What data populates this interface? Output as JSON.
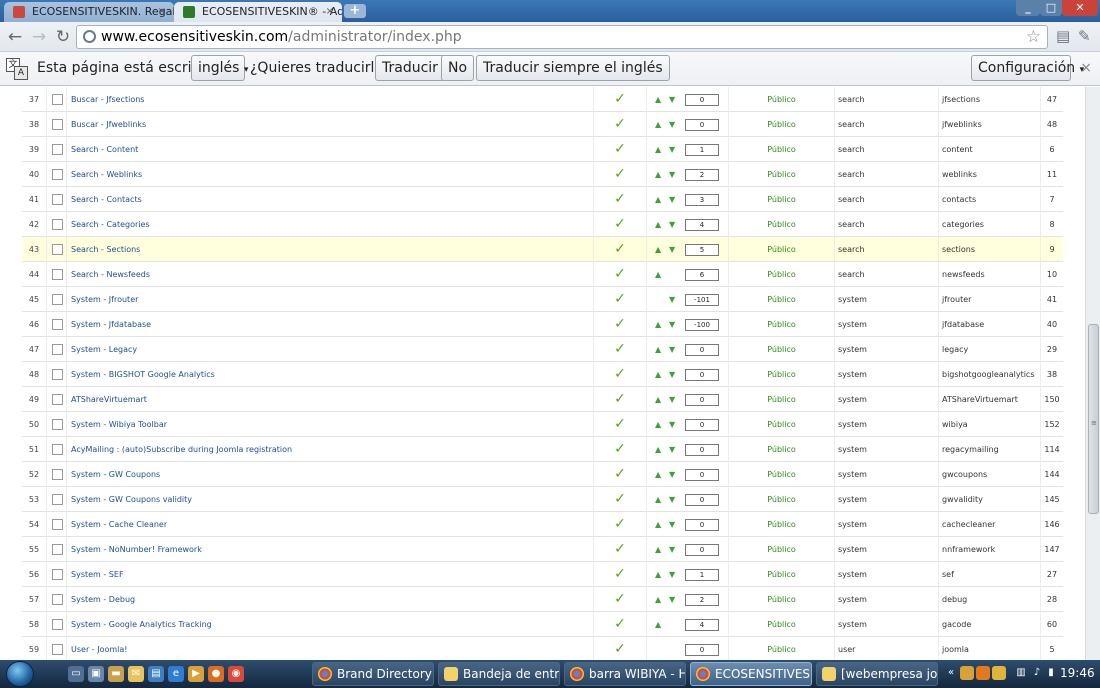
{
  "browser": {
    "tabs": [
      {
        "label": "ECOSENSITIVESKIN. Regalo",
        "close": "×"
      },
      {
        "label": "ECOSENSITIVESKIN® - Adm",
        "close": "×"
      }
    ],
    "new_tab": "+",
    "url_host": "www.ecosensitiveskin.com",
    "url_path": "/administrator/index.php"
  },
  "translate_bar": {
    "text": "Esta página está escrita en",
    "language": "inglés",
    "question": "¿Quieres traducirla?",
    "translate_button": "Traducir",
    "no_button": "No",
    "always_button": "Traducir siempre el inglés",
    "config_button": "Configuración",
    "close": "×"
  },
  "colors": {
    "link": "#1d4f91",
    "enabled_check": "#56a21d",
    "access_public": "#2f8a16",
    "highlight_row": "#ffffdd"
  },
  "rows": [
    {
      "num": "37",
      "name": "Buscar - Jfsections",
      "up": true,
      "down": true,
      "order": "0",
      "access": "Público",
      "type": "search",
      "element": "jfsections",
      "id": "47"
    },
    {
      "num": "38",
      "name": "Buscar - Jfweblinks",
      "up": true,
      "down": true,
      "order": "0",
      "access": "Público",
      "type": "search",
      "element": "jfweblinks",
      "id": "48"
    },
    {
      "num": "39",
      "name": "Search - Content",
      "up": true,
      "down": true,
      "order": "1",
      "access": "Público",
      "type": "search",
      "element": "content",
      "id": "6"
    },
    {
      "num": "40",
      "name": "Search - Weblinks",
      "up": true,
      "down": true,
      "order": "2",
      "access": "Público",
      "type": "search",
      "element": "weblinks",
      "id": "11"
    },
    {
      "num": "41",
      "name": "Search - Contacts",
      "up": true,
      "down": true,
      "order": "3",
      "access": "Público",
      "type": "search",
      "element": "contacts",
      "id": "7"
    },
    {
      "num": "42",
      "name": "Search - Categories",
      "up": true,
      "down": true,
      "order": "4",
      "access": "Público",
      "type": "search",
      "element": "categories",
      "id": "8"
    },
    {
      "num": "43",
      "name": "Search - Sections",
      "up": true,
      "down": true,
      "order": "5",
      "access": "Público",
      "type": "search",
      "element": "sections",
      "id": "9",
      "highlight": true
    },
    {
      "num": "44",
      "name": "Search - Newsfeeds",
      "up": true,
      "down": false,
      "order": "6",
      "access": "Público",
      "type": "search",
      "element": "newsfeeds",
      "id": "10"
    },
    {
      "num": "45",
      "name": "System - Jfrouter",
      "up": false,
      "down": true,
      "order": "-101",
      "access": "Público",
      "type": "system",
      "element": "jfrouter",
      "id": "41"
    },
    {
      "num": "46",
      "name": "System - Jfdatabase",
      "up": true,
      "down": true,
      "order": "-100",
      "access": "Público",
      "type": "system",
      "element": "jfdatabase",
      "id": "40"
    },
    {
      "num": "47",
      "name": "System - Legacy",
      "up": true,
      "down": true,
      "order": "0",
      "access": "Público",
      "type": "system",
      "element": "legacy",
      "id": "29"
    },
    {
      "num": "48",
      "name": "System - BIGSHOT Google Analytics",
      "up": true,
      "down": true,
      "order": "0",
      "access": "Público",
      "type": "system",
      "element": "bigshotgoogleanalytics",
      "id": "38"
    },
    {
      "num": "49",
      "name": "ATShareVirtuemart",
      "up": true,
      "down": true,
      "order": "0",
      "access": "Público",
      "type": "system",
      "element": "ATShareVirtuemart",
      "id": "150"
    },
    {
      "num": "50",
      "name": "System - Wibiya Toolbar",
      "up": true,
      "down": true,
      "order": "0",
      "access": "Público",
      "type": "system",
      "element": "wibiya",
      "id": "152"
    },
    {
      "num": "51",
      "name": "AcyMailing : (auto)Subscribe during Joomla registration",
      "up": true,
      "down": true,
      "order": "0",
      "access": "Público",
      "type": "system",
      "element": "regacymailing",
      "id": "114"
    },
    {
      "num": "52",
      "name": "System - GW Coupons",
      "up": true,
      "down": true,
      "order": "0",
      "access": "Público",
      "type": "system",
      "element": "gwcoupons",
      "id": "144"
    },
    {
      "num": "53",
      "name": "System - GW Coupons validity",
      "up": true,
      "down": true,
      "order": "0",
      "access": "Público",
      "type": "system",
      "element": "gwvalidity",
      "id": "145"
    },
    {
      "num": "54",
      "name": "System - Cache Cleaner",
      "up": true,
      "down": true,
      "order": "0",
      "access": "Público",
      "type": "system",
      "element": "cachecleaner",
      "id": "146"
    },
    {
      "num": "55",
      "name": "System - NoNumber! Framework",
      "up": true,
      "down": true,
      "order": "0",
      "access": "Público",
      "type": "system",
      "element": "nnframework",
      "id": "147"
    },
    {
      "num": "56",
      "name": "System - SEF",
      "up": true,
      "down": true,
      "order": "1",
      "access": "Público",
      "type": "system",
      "element": "sef",
      "id": "27"
    },
    {
      "num": "57",
      "name": "System - Debug",
      "up": true,
      "down": true,
      "order": "2",
      "access": "Público",
      "type": "system",
      "element": "debug",
      "id": "28"
    },
    {
      "num": "58",
      "name": "System - Google Analytics Tracking",
      "up": true,
      "down": false,
      "order": "4",
      "access": "Público",
      "type": "system",
      "element": "gacode",
      "id": "60"
    },
    {
      "num": "59",
      "name": "User - Joomla!",
      "up": false,
      "down": false,
      "order": "0",
      "access": "Público",
      "type": "user",
      "element": "joomla",
      "id": "5"
    }
  ],
  "scroll_position": 0.62,
  "taskbar": {
    "tasks": [
      {
        "label": "Brand Directory - ..."
      },
      {
        "label": "Bandeja de entra..."
      },
      {
        "label": "barra WIBIYA - H..."
      },
      {
        "label": "ECOSENSITIVESKI..."
      },
      {
        "label": "[webempresa joo..."
      }
    ],
    "clock": "19:46"
  }
}
